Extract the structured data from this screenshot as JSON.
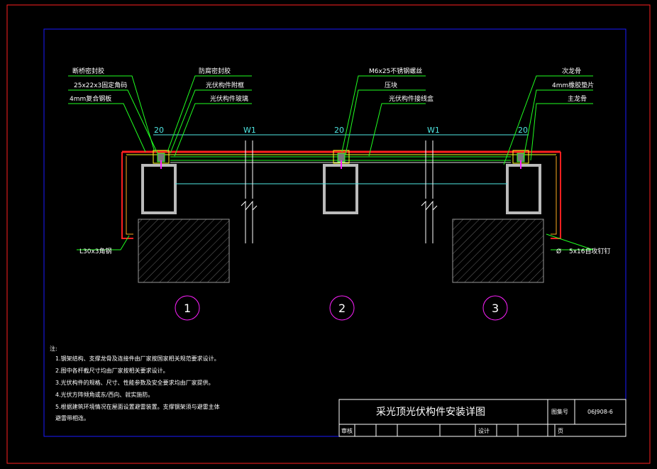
{
  "callouts_left": [
    "断桥密封胶",
    "25x22x3固定角码",
    "4mm复合钢板"
  ],
  "callouts_mid_left": [
    "防腐密封胶",
    "光伏构件附框",
    "光伏构件玻璃"
  ],
  "callouts_center": [
    "M6x25不锈钢螺丝",
    "压块",
    "光伏构件接线盒"
  ],
  "callouts_right": [
    "次龙骨",
    "4mm橡胶垫片",
    "主龙骨"
  ],
  "dims": {
    "d20": "20",
    "w1": "W1"
  },
  "bottom_labels": {
    "angle": "L30x3角钢",
    "phi": "Ø",
    "screw": "5x16自攻钉钉"
  },
  "node_numbers": [
    "1",
    "2",
    "3"
  ],
  "notes": {
    "title": "注:",
    "lines": [
      "1.钢架结构、支撑龙骨及连接件由厂家按国家相关规范要求设计。",
      "2.图中各杆截尺寸均由厂家按相关要求设计。",
      "3.光伏构件的规格、尺寸、性能参数及安全要求均由厂家提供。",
      "4.光伏方阵倾角或东/西向、就实施防。",
      "5.根据建筑环境情况在屋面设置避雷装置。支撑钢架须与避雷主体",
      "  避雷带相连。"
    ]
  },
  "title_block": {
    "title": "采光顶光伏构件安装详图",
    "atlas_label": "图集号",
    "atlas_no": "06J908-6",
    "review": "审核",
    "design": "设计",
    "page": "页"
  },
  "colors": {
    "frame": "#ff2020",
    "border": "#1a1aff",
    "leader": "#20ff20",
    "pipe": "#b0b0b0",
    "cyan": "#4fe7e3",
    "magenta": "#ff20ff",
    "yellow": "#ffff20"
  }
}
